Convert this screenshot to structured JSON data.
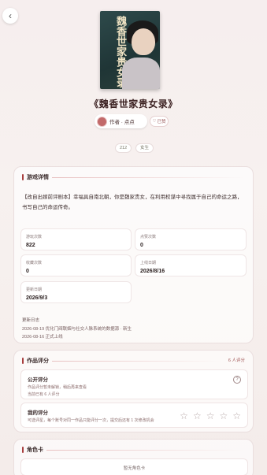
{
  "book": {
    "title": "《魏香世家贵女录》",
    "cover_text": "魏香世家贵女录"
  },
  "author": {
    "label": "作者 · 点点"
  },
  "follow": {
    "icon": "heart-icon",
    "label": "已赞"
  },
  "tags": [
    "212",
    "女生"
  ],
  "details": {
    "title": "游戏详情",
    "description": "【改自出嫁前评剧本】幸福具自南北朝，你是魏家贵女，在利用权谋中寻找属于自己的命运之路，书写自己的命运传奇。",
    "stats": [
      {
        "label": "游玩次数",
        "value": "822"
      },
      {
        "label": "点赞次数",
        "value": "0"
      },
      {
        "label": "收藏次数",
        "value": "0"
      },
      {
        "label": "上线日期",
        "value": "2026/8/16"
      },
      {
        "label": "更新日期",
        "value": "2026/9/3"
      }
    ],
    "log_title": "更新日志",
    "log_lines": [
      "2026-08-19 优化门阀联姻与社交人脉系统的数据源 · 新生",
      "2026-08-16 正式上线"
    ]
  },
  "rating": {
    "title": "作品评分",
    "participants": "6 人评分",
    "public": {
      "title": "公开评分",
      "line1": "作品评分暂未解锁，稍后再来查看",
      "line2": "当前已有 6 人评分"
    },
    "mine": {
      "title": "我的评分",
      "hint": "可选评星，每个账号对同一作品只能评分一次，提交后还有 1 次修改机会"
    },
    "stars": 5
  },
  "roles": {
    "title": "角色卡",
    "empty_text": "暂无角色卡"
  },
  "colors": {
    "accent": "#a83e3e",
    "background": "#f6eeee"
  }
}
